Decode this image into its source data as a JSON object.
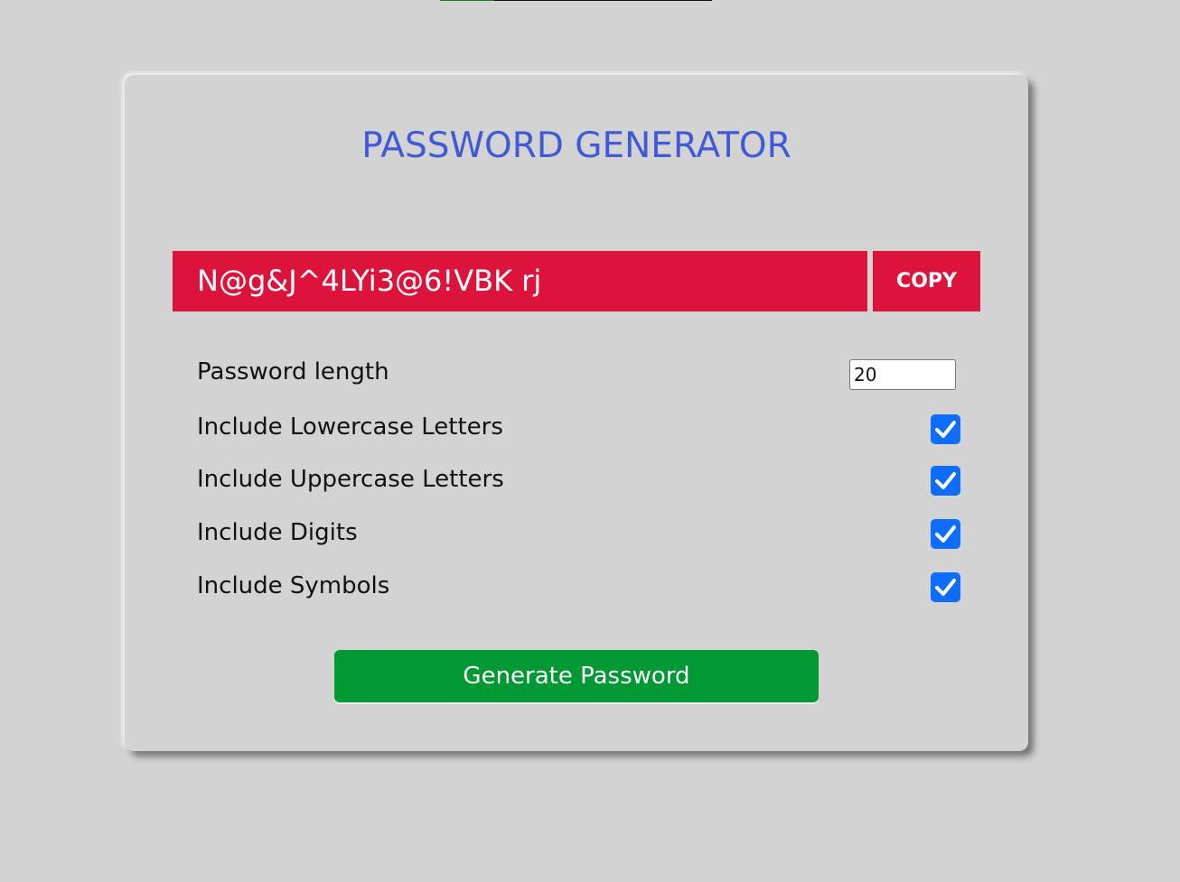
{
  "app": {
    "title": "PASSWORD GENERATOR"
  },
  "password": {
    "value": "N@g&J^4LYi3@6!VBK rj",
    "copy_label": "COPY"
  },
  "settings": {
    "length_label": "Password length",
    "length_value": "20",
    "options": [
      {
        "label": "Include Lowercase Letters",
        "checked": true
      },
      {
        "label": "Include Uppercase Letters",
        "checked": true
      },
      {
        "label": "Include Digits",
        "checked": true
      },
      {
        "label": "Include Symbols",
        "checked": true
      }
    ]
  },
  "actions": {
    "generate_label": "Generate Password"
  },
  "colors": {
    "title": "#3f5ad8",
    "password_bg": "#dc143c",
    "checkbox": "#0d6efd",
    "generate_bg": "#009933",
    "page_bg": "#d3d3d3"
  },
  "icons": {
    "checkbox_mark": "check-icon"
  }
}
